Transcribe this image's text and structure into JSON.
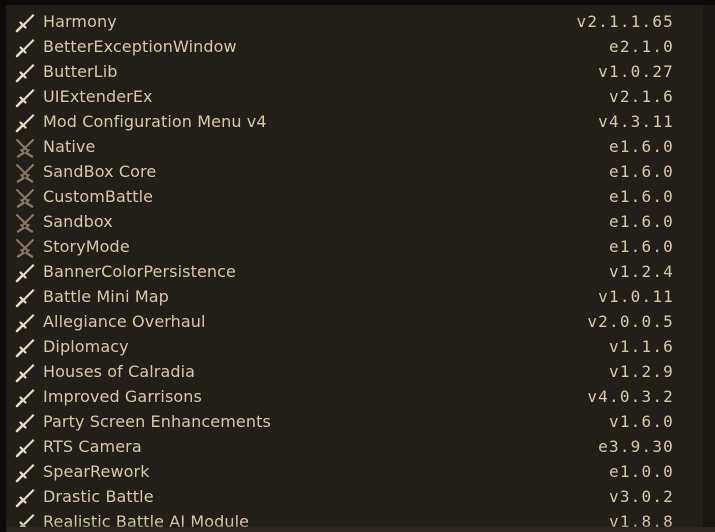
{
  "mods": [
    {
      "name": "Harmony",
      "version": "v2.1.1.65",
      "icon": "sword-icon"
    },
    {
      "name": "BetterExceptionWindow",
      "version": "e2.1.0",
      "icon": "sword-icon"
    },
    {
      "name": "ButterLib",
      "version": "v1.0.27",
      "icon": "sword-icon"
    },
    {
      "name": "UIExtenderEx",
      "version": "v2.1.6",
      "icon": "sword-icon"
    },
    {
      "name": "Mod Configuration Menu v4",
      "version": "v4.3.11",
      "icon": "sword-icon"
    },
    {
      "name": "Native",
      "version": "e1.6.0",
      "icon": "crossed-swords-icon"
    },
    {
      "name": "SandBox Core",
      "version": "e1.6.0",
      "icon": "crossed-swords-icon"
    },
    {
      "name": "CustomBattle",
      "version": "e1.6.0",
      "icon": "crossed-swords-icon"
    },
    {
      "name": "Sandbox",
      "version": "e1.6.0",
      "icon": "crossed-swords-icon"
    },
    {
      "name": "StoryMode",
      "version": "e1.6.0",
      "icon": "crossed-swords-icon"
    },
    {
      "name": "BannerColorPersistence",
      "version": "v1.2.4",
      "icon": "sword-icon"
    },
    {
      "name": "Battle Mini Map",
      "version": "v1.0.11",
      "icon": "sword-icon"
    },
    {
      "name": "Allegiance Overhaul",
      "version": "v2.0.0.5",
      "icon": "sword-icon"
    },
    {
      "name": "Diplomacy",
      "version": "v1.1.6",
      "icon": "sword-icon"
    },
    {
      "name": "Houses of Calradia",
      "version": "v1.2.9",
      "icon": "sword-icon"
    },
    {
      "name": "Improved Garrisons",
      "version": "v4.0.3.2",
      "icon": "sword-icon"
    },
    {
      "name": "Party Screen Enhancements",
      "version": "v1.6.0",
      "icon": "sword-icon"
    },
    {
      "name": "RTS Camera",
      "version": "e3.9.30",
      "icon": "sword-icon"
    },
    {
      "name": "SpearRework",
      "version": "e1.0.0",
      "icon": "sword-icon"
    },
    {
      "name": "Drastic Battle",
      "version": "v3.0.2",
      "icon": "sword-icon"
    },
    {
      "name": "Realistic Battle AI Module",
      "version": "v1.8.8",
      "icon": "sword-icon"
    }
  ],
  "colors": {
    "text": "#d9c8a8",
    "sword": "#e8dcc4",
    "native_sword": "#8a7a63",
    "border": "#8a7556"
  }
}
